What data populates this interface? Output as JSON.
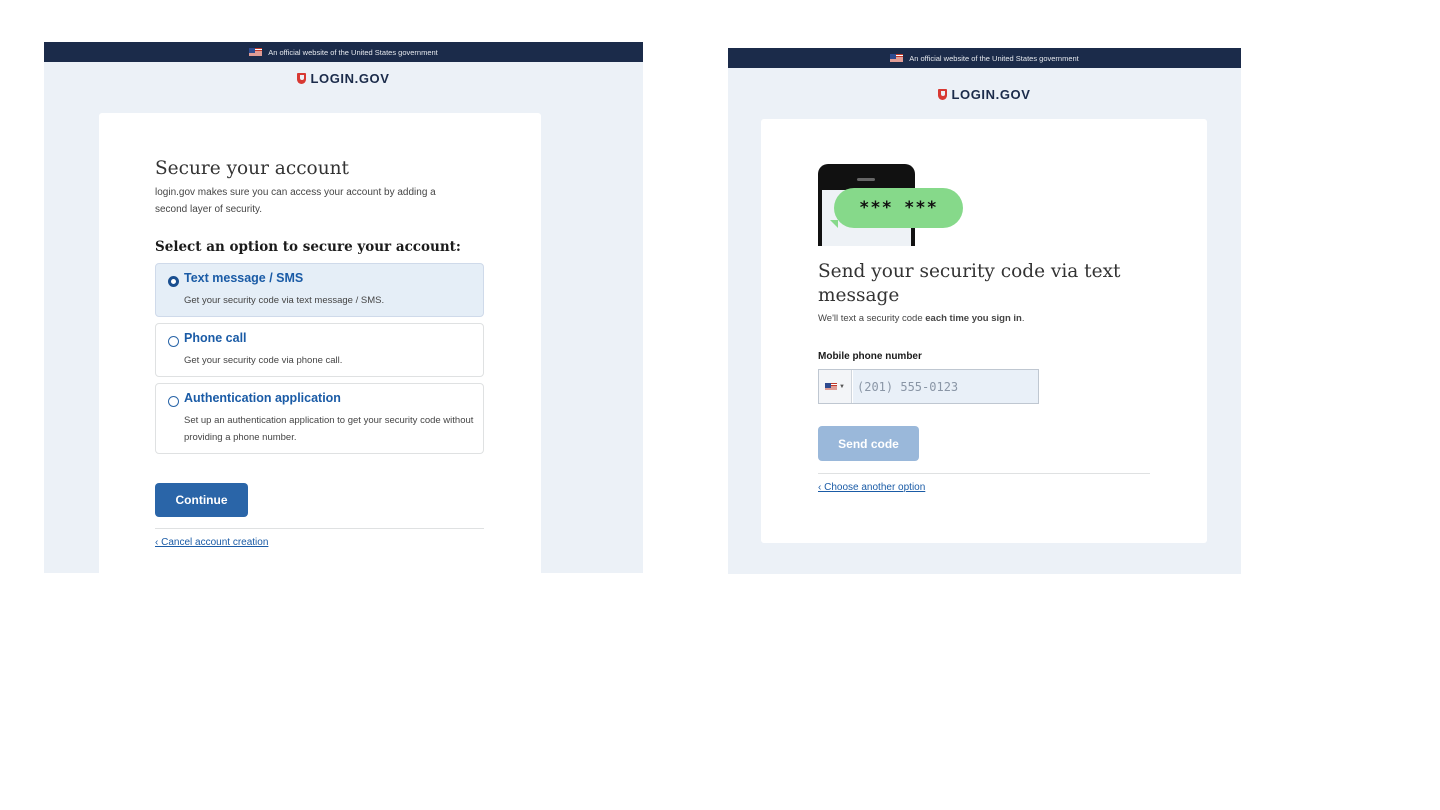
{
  "left_screen": {
    "banner_text": "An official website of the United States government",
    "logo_text": "LOGIN.GOV",
    "title": "Secure your account",
    "intro": "login.gov makes sure you can access your account by adding a second layer of security.",
    "select_heading": "Select an option to secure your account:",
    "options": [
      {
        "title": "Text message / SMS",
        "description": "Get your security code via text message / SMS.",
        "selected": true
      },
      {
        "title": "Phone call",
        "description": "Get your security code via phone call.",
        "selected": false
      },
      {
        "title": "Authentication application",
        "description": "Set up an authentication application to get your security code without providing a phone number.",
        "selected": false
      }
    ],
    "continue_label": "Continue",
    "cancel_link": "‹ Cancel account creation"
  },
  "right_screen": {
    "banner_text": "An official website of the United States government",
    "logo_text": "LOGIN.GOV",
    "illustration_code": "*** ***",
    "title": "Send your security code via text message",
    "intro_prefix": "We'll text a security code ",
    "intro_bold": "each time you sign in",
    "intro_suffix": ".",
    "phone_label": "Mobile phone number",
    "phone_placeholder": "(201) 555-0123",
    "send_label": "Send code",
    "choose_link": "‹ Choose another option"
  },
  "colors": {
    "banner": "#1b2b4a",
    "panel_bg": "#ecf1f7",
    "primary": "#2a65a8",
    "primary_disabled": "#9ab8da",
    "bubble_green": "#86d98a",
    "logo_red": "#d83933"
  },
  "icons": [
    "us-flag-icon",
    "login-shield-icon",
    "radio-icon",
    "phone-illustration",
    "chevron-down-icon"
  ]
}
